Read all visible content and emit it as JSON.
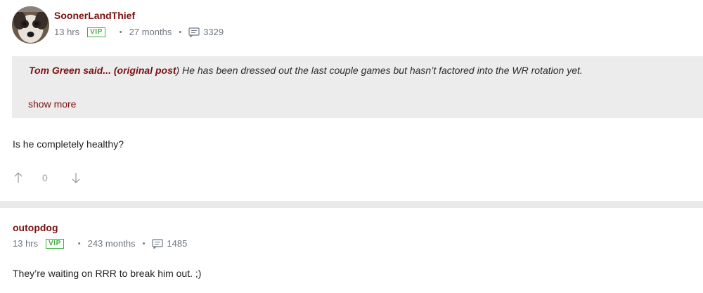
{
  "posts": [
    {
      "username": "SoonerLandThief",
      "time": "13 hrs",
      "badge": "VIP",
      "membership": "27 months",
      "post_count": "3329",
      "quote": {
        "author": "Tom Green said...",
        "link": "original post",
        "text": " He has been dressed out the last couple games but hasn’t factored into the WR rotation yet.",
        "show_more": "show more"
      },
      "body": "Is he completely healthy?",
      "vote_count": "0"
    },
    {
      "username": "outopdog",
      "time": "13 hrs",
      "badge": "VIP",
      "membership": "243 months",
      "post_count": "1485",
      "body": "They’re waiting on RRR to break him out. ;)"
    }
  ],
  "colors": {
    "username": "#7a1010",
    "vip": "#3fae3f",
    "meta": "#6f7780",
    "quote_bg": "#ececec",
    "page_bg": "#e9e9e9"
  },
  "icons": {
    "posts": "message-square-icon",
    "upvote": "arrow-up-icon",
    "downvote": "arrow-down-icon"
  }
}
